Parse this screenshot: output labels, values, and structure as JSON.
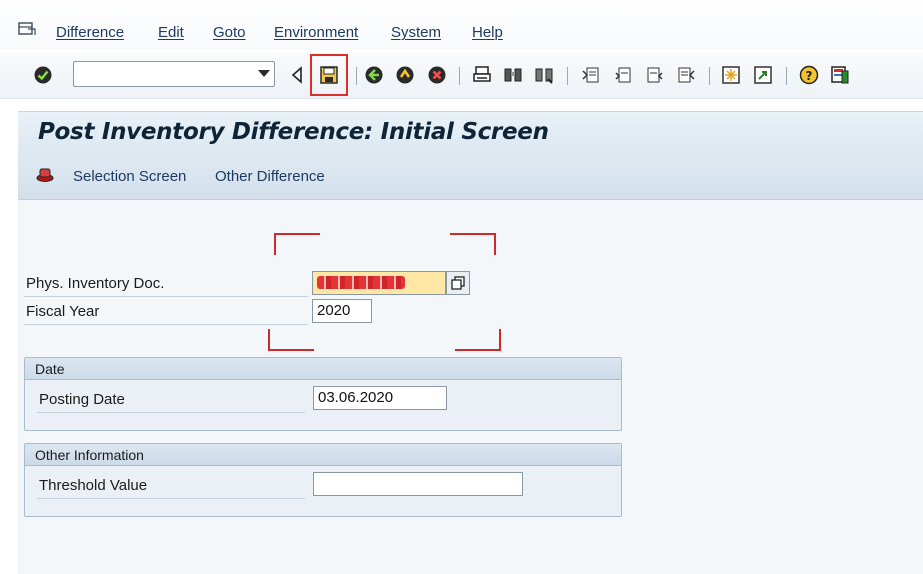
{
  "menu": {
    "items": [
      "Difference",
      "Edit",
      "Goto",
      "Environment",
      "System",
      "Help"
    ]
  },
  "toolbar": {
    "command_field_value": "",
    "icons": [
      "enter-icon",
      "back-icon",
      "exit-icon",
      "cancel-icon",
      "print-icon",
      "find-icon",
      "find-next-icon",
      "first-page-icon",
      "previous-page-icon",
      "next-page-icon",
      "last-page-icon",
      "create-session-icon",
      "shortcut-icon",
      "help-icon",
      "customize-layout-icon"
    ]
  },
  "title": "Post Inventory Difference: Initial Screen",
  "app_toolbar": {
    "selection_screen": "Selection Screen",
    "other_difference": "Other Difference"
  },
  "fields": {
    "phys_inventory_doc": {
      "label": "Phys. Inventory Doc.",
      "value": ""
    },
    "fiscal_year": {
      "label": "Fiscal Year",
      "value": "2020"
    }
  },
  "groups": {
    "date": {
      "title": "Date",
      "posting_date": {
        "label": "Posting Date",
        "value": "03.06.2020"
      }
    },
    "other_information": {
      "title": "Other Information",
      "threshold_value": {
        "label": "Threshold Value",
        "value": ""
      }
    }
  },
  "colors": {
    "highlight": "#d9302c",
    "required_field": "#ffe8a6",
    "title_bg": "#dbe7f1"
  }
}
